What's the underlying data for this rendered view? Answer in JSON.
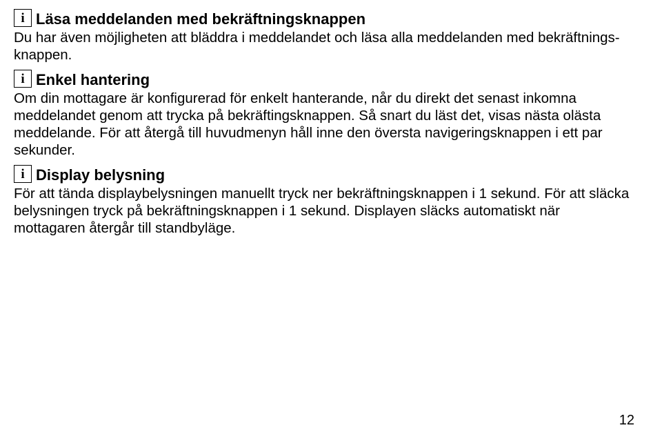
{
  "sections": [
    {
      "icon": "i",
      "heading": "Läsa meddelanden med bekräftningsknappen",
      "body": "Du har även möjligheten att bläddra i meddelandet och läsa alla meddelanden med bekräftnings-knappen."
    },
    {
      "icon": "i",
      "heading": "Enkel hantering",
      "body": "Om din mottagare är konfigurerad för enkelt hanterande, når du direkt det senast inkomna meddelandet genom att trycka på bekräftingsknappen. Så snart du läst det, visas nästa olästa meddelande. För att återgå till huvudmenyn håll inne den översta navigeringsknappen i ett par sekunder."
    },
    {
      "icon": "i",
      "heading": "Display belysning",
      "body": "För att tända displaybelysningen manuellt tryck ner bekräftningsknappen i 1 sekund. För att släcka belysningen tryck på bekräftningsknappen i 1 sekund. Displayen släcks automatiskt när mottagaren återgår till standbyläge."
    }
  ],
  "pageNumber": "12"
}
